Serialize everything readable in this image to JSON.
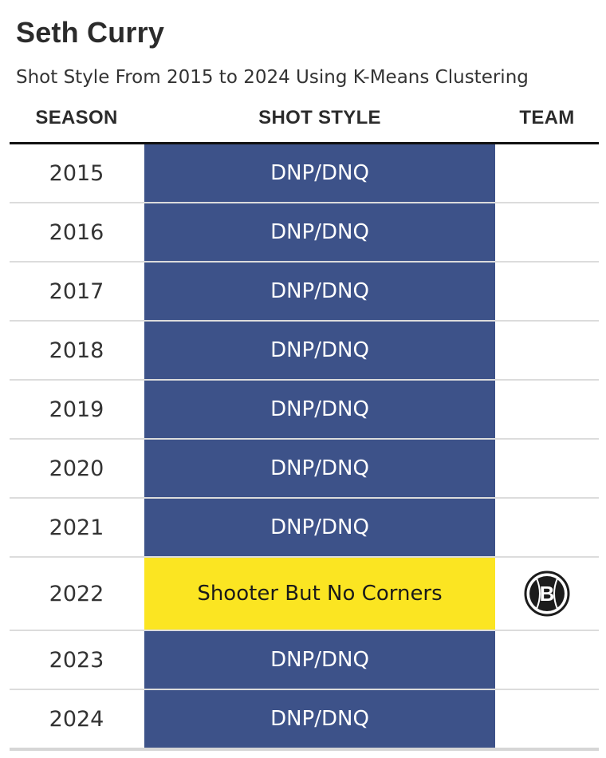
{
  "title": "Seth Curry",
  "subtitle": "Shot Style From 2015 to 2024 Using K-Means Clustering",
  "columns": {
    "season": "SEASON",
    "shot_style": "SHOT STYLE",
    "team": "TEAM"
  },
  "colors": {
    "dnp": "#3d5289",
    "shooter_but_no_corners": "#fbe522",
    "text_on_dark": "#ffffff",
    "text_on_light": "#1a1a1a"
  },
  "chart_data": {
    "type": "table",
    "title": "Seth Curry",
    "subtitle": "Shot Style From 2015 to 2024 Using K-Means Clustering",
    "columns": [
      "SEASON",
      "SHOT STYLE",
      "TEAM"
    ],
    "rows": [
      {
        "season": "2015",
        "shot_style": "DNP/DNQ",
        "category": "dnp",
        "team": ""
      },
      {
        "season": "2016",
        "shot_style": "DNP/DNQ",
        "category": "dnp",
        "team": ""
      },
      {
        "season": "2017",
        "shot_style": "DNP/DNQ",
        "category": "dnp",
        "team": ""
      },
      {
        "season": "2018",
        "shot_style": "DNP/DNQ",
        "category": "dnp",
        "team": ""
      },
      {
        "season": "2019",
        "shot_style": "DNP/DNQ",
        "category": "dnp",
        "team": ""
      },
      {
        "season": "2020",
        "shot_style": "DNP/DNQ",
        "category": "dnp",
        "team": ""
      },
      {
        "season": "2021",
        "shot_style": "DNP/DNQ",
        "category": "dnp",
        "team": ""
      },
      {
        "season": "2022",
        "shot_style": "Shooter But No Corners",
        "category": "shooter_but_no_corners",
        "team": "brooklyn-nets-logo",
        "team_logo_letter": "B"
      },
      {
        "season": "2023",
        "shot_style": "DNP/DNQ",
        "category": "dnp",
        "team": ""
      },
      {
        "season": "2024",
        "shot_style": "DNP/DNQ",
        "category": "dnp",
        "team": ""
      }
    ]
  }
}
